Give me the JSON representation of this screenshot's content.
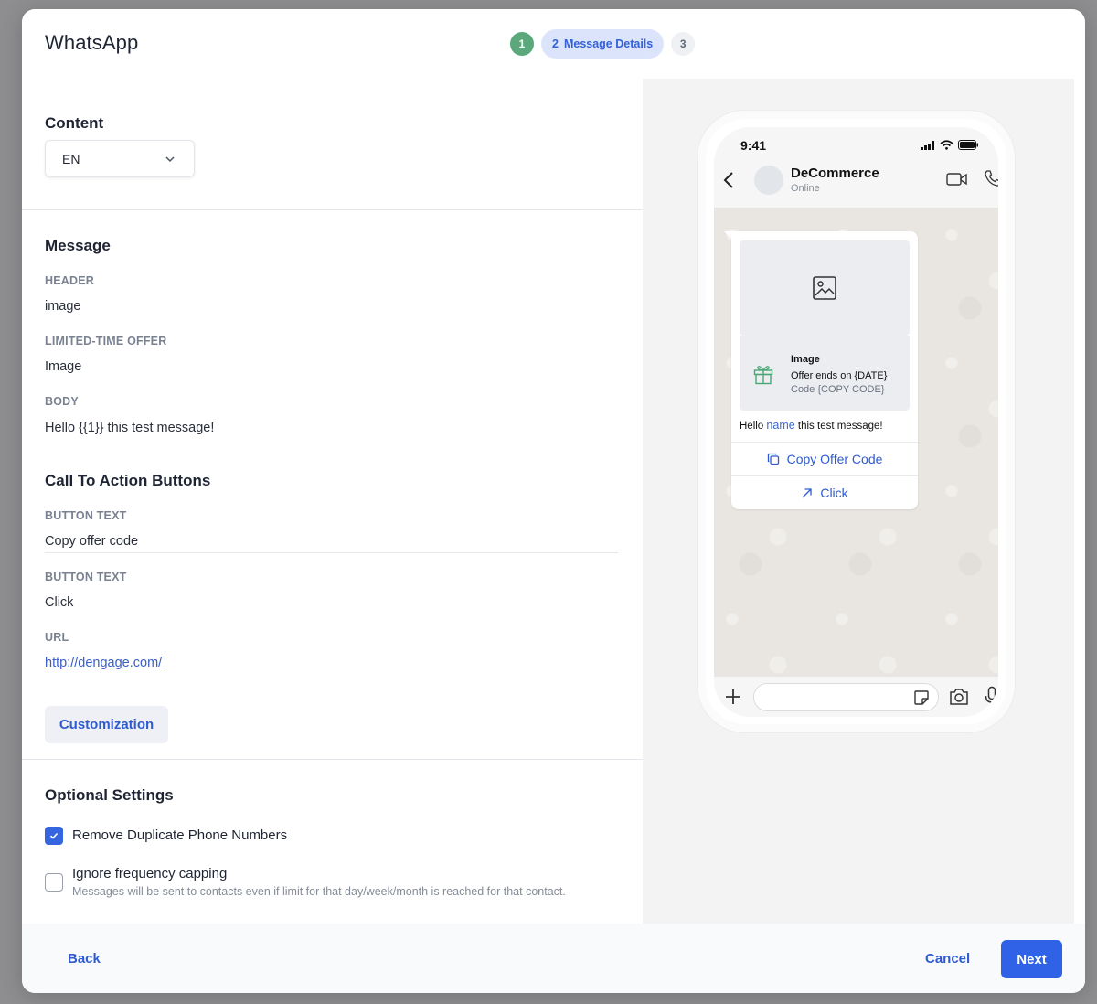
{
  "modal": {
    "title": "WhatsApp",
    "steps": [
      {
        "number": "1",
        "state": "done"
      },
      {
        "number": "2",
        "label": "Message Details",
        "state": "active"
      },
      {
        "number": "3",
        "state": "pending"
      }
    ]
  },
  "content": {
    "title": "Content",
    "language_select": {
      "value": "EN"
    }
  },
  "message": {
    "title": "Message",
    "fields": [
      {
        "label": "HEADER",
        "value": "image"
      },
      {
        "label": "LIMITED-TIME OFFER",
        "value": "Image"
      },
      {
        "label": "BODY",
        "value": "Hello {{1}} this test message!"
      }
    ]
  },
  "cta": {
    "title": "Call To Action Buttons",
    "fields": [
      {
        "label": "BUTTON TEXT",
        "value": "Copy offer code"
      },
      {
        "label": "BUTTON TEXT",
        "value": "Click"
      },
      {
        "label": "URL",
        "value": "http://dengage.com/"
      }
    ],
    "customization_label": "Customization"
  },
  "optional": {
    "title": "Optional Settings",
    "remove_duplicates": {
      "label": "Remove Duplicate Phone Numbers",
      "checked": true
    },
    "ignore_capping": {
      "label": "Ignore frequency capping",
      "description": "Messages will be sent to contacts even if limit for that day/week/month is reached for that contact.",
      "checked": false
    }
  },
  "preview": {
    "time": "9:41",
    "contact_name": "DeCommerce",
    "contact_status": "Online",
    "offer": {
      "title": "Image",
      "ends": "Offer ends on {DATE}",
      "code": "Code {COPY CODE}"
    },
    "body_prefix": "Hello",
    "body_variable": "name",
    "body_suffix": "this test message!",
    "buttons": [
      "Copy Offer Code",
      "Click"
    ]
  },
  "footer": {
    "back_label": "Back",
    "cancel_label": "Cancel",
    "next_label": "Next"
  },
  "colors": {
    "accent": "#2f62e6",
    "step_done": "#5ba87c",
    "link": "#3a5fc7"
  }
}
